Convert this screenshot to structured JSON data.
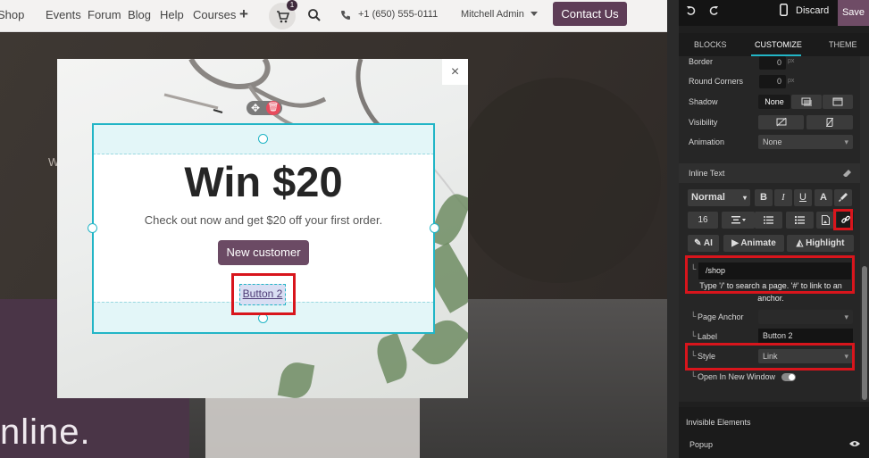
{
  "nav": {
    "links": [
      "Shop",
      "Events",
      "Forum",
      "Blog",
      "Help",
      "Courses"
    ],
    "plus": "+",
    "cart_count": "1",
    "phone": "+1 (650) 555-0111",
    "user": "Mitchell Admin",
    "contact_label": "Contact Us"
  },
  "hero": {
    "partial_text": "W",
    "online_text": "nline."
  },
  "popup": {
    "close": "×",
    "title": "Win $20",
    "subtitle": "Check out now and get $20 off your first order.",
    "primary_button": "New customer",
    "secondary_link": "Button 2",
    "move_glyph": "✥",
    "trash_glyph": "🗑"
  },
  "panel": {
    "discard_label": "Discard",
    "save_label": "Save",
    "tabs": [
      "BLOCKS",
      "CUSTOMIZE",
      "THEME"
    ],
    "border_label": "Border",
    "border_value": "0",
    "round_corners_label": "Round Corners",
    "round_corners_value": "0",
    "unit": "px",
    "shadow_label": "Shadow",
    "shadow_none": "None",
    "visibility_label": "Visibility",
    "animation_label": "Animation",
    "animation_value": "None",
    "inline_text_header": "Inline Text",
    "format_value": "Normal",
    "bold": "B",
    "italic": "I",
    "underline": "U",
    "font_size": "16",
    "ai_label": "AI",
    "animate_label": "Animate",
    "highlight_label": "Highlight",
    "url_value": "/shop",
    "url_hint": "Type '/' to search a page. '#' to link to an anchor.",
    "page_anchor_label": "Page Anchor",
    "label_label": "Label",
    "label_value": "Button 2",
    "style_label": "Style",
    "style_value": "Link",
    "open_new_window_label": "Open In New Window",
    "invisible_elements_label": "Invisible Elements",
    "popup_label": "Popup",
    "sub_marker": "└"
  },
  "colors": {
    "accent": "#22b5c6",
    "brand": "#5e3d57",
    "highlight_red": "#d8151c",
    "save": "#6f4c66"
  }
}
